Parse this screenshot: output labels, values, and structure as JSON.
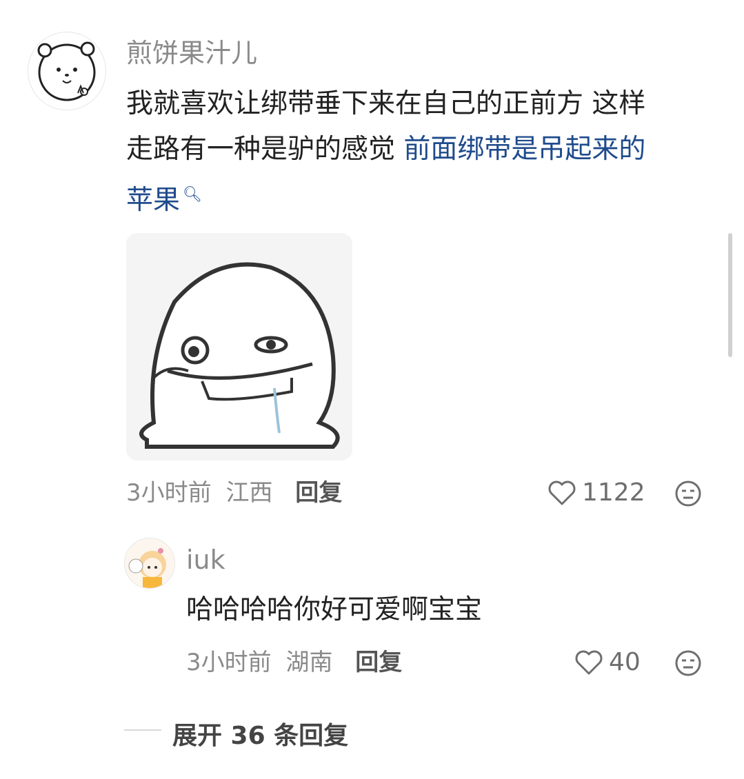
{
  "comment": {
    "username": "煎饼果汁儿",
    "text_line1": "我就喜欢让绑带垂下来在自己的正前方 这样",
    "text_line2_plain": "走路有一种是驴的感觉 ",
    "text_line2_link": "前面绑带是吊起来的",
    "text_line3_link": "苹果",
    "time": "3小时前",
    "location": "江西",
    "reply_label": "回复",
    "like_count": "1122",
    "avatar_icon": "polar-bear-avatar-icon",
    "sticker_icon": "meme-sticker-image"
  },
  "reply": {
    "username": "iuk",
    "text": "哈哈哈哈你好可爱啊宝宝",
    "time": "3小时前",
    "location": "湖南",
    "reply_label": "回复",
    "like_count": "40",
    "avatar_icon": "anime-girl-avatar-icon"
  },
  "expand": {
    "label": "展开 36 条回复"
  },
  "colors": {
    "link": "#1f4b8c",
    "meta": "#8a8a8a",
    "text": "#222222"
  }
}
